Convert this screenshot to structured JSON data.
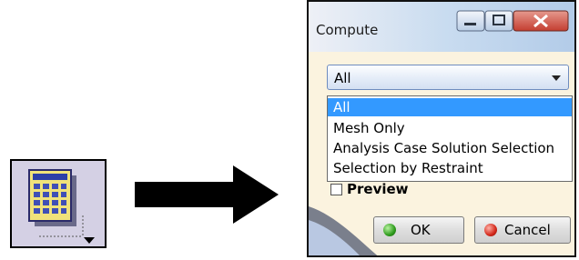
{
  "toolbar_icon": {
    "name": "compute-icon"
  },
  "arrow": {
    "name": "right-arrow"
  },
  "dialog": {
    "title": "Compute",
    "window_controls": [
      "minimize",
      "maximize",
      "close"
    ],
    "combo": {
      "selected": "All"
    },
    "options": [
      "All",
      "Mesh Only",
      "Analysis Case Solution Selection",
      "Selection by Restraint"
    ],
    "highlighted_index": 0,
    "preview": {
      "label": "Preview",
      "checked": false
    },
    "buttons": {
      "ok": "OK",
      "cancel": "Cancel"
    },
    "colors": {
      "highlight": "#3399ff",
      "close_button": "#c9463d",
      "ok_dot": "#2e9b1c",
      "cancel_dot": "#d3281a"
    }
  }
}
